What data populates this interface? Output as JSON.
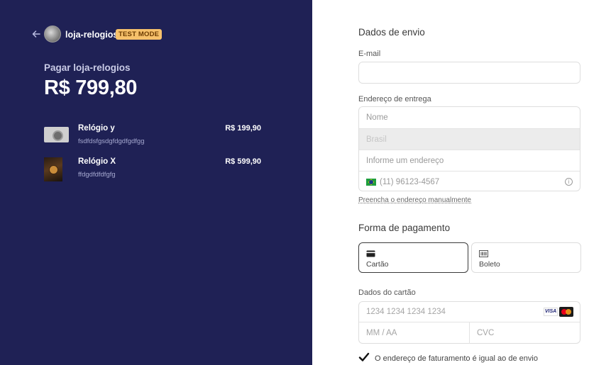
{
  "store": {
    "name": "loja-relogios",
    "badge": "TEST MODE"
  },
  "summary": {
    "pay_label": "Pagar loja-relogios",
    "total": "R$ 799,80"
  },
  "items": [
    {
      "name": "Relógio y",
      "description": "fsdfdsfgsdgfdgdfgdfgg",
      "price": "R$ 199,90"
    },
    {
      "name": "Relógio X",
      "description": "ffdgdfdfdfgfg",
      "price": "R$ 599,90"
    }
  ],
  "shipping": {
    "title": "Dados de envio",
    "email_label": "E-mail",
    "email_value": "",
    "address_label": "Endereço de entrega",
    "name_placeholder": "Nome",
    "country": "Brasil",
    "address_placeholder": "Informe um endereço",
    "phone_placeholder": "(11) 96123-4567",
    "manual_link": "Preencha o endereço manualmente"
  },
  "payment": {
    "title": "Forma de pagamento",
    "methods": [
      {
        "label": "Cartão",
        "icon": "credit-card-icon",
        "selected": true
      },
      {
        "label": "Boleto",
        "icon": "barcode-icon",
        "selected": false
      }
    ],
    "card_label": "Dados do cartão",
    "card_number_placeholder": "1234 1234 1234 1234",
    "expiry_placeholder": "MM / AA",
    "cvc_placeholder": "CVC",
    "brands": [
      "VISA",
      "mastercard"
    ],
    "billing_same": "O endereço de faturamento é igual ao de envio",
    "billing_checked": true
  },
  "colors": {
    "left_bg": "#1f2155",
    "badge_bg": "#f7c16b",
    "badge_text": "#6b3a00"
  }
}
